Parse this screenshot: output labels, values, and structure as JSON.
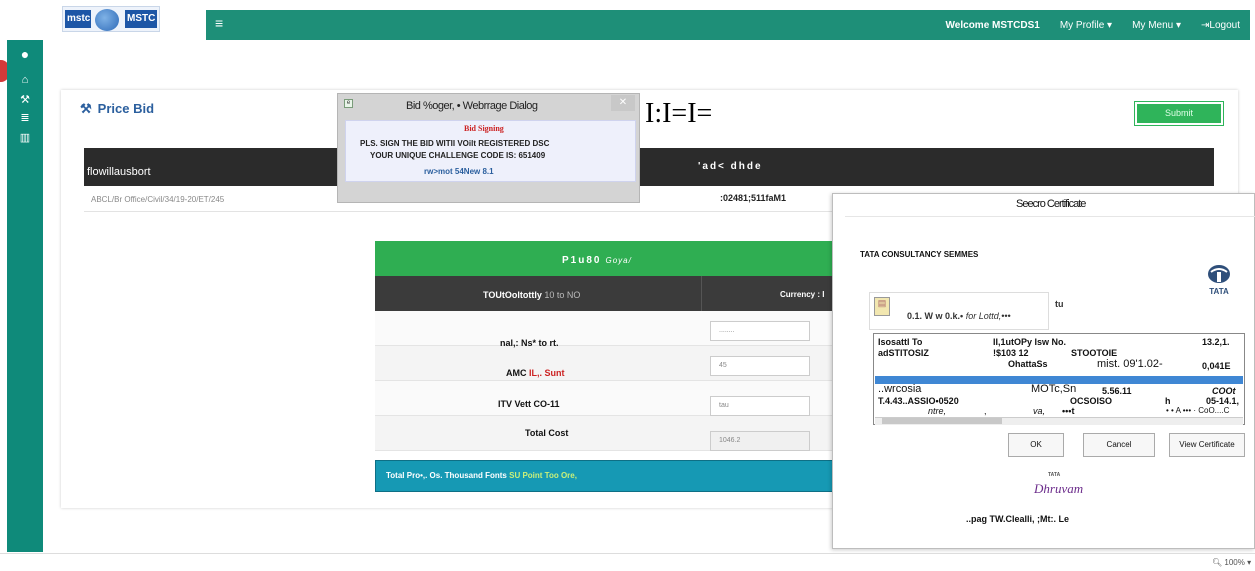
{
  "nav": {
    "logo_left": "mstc",
    "logo_right": "MSTC",
    "welcome": "Welcome MSTCDS1",
    "my_profile": "My Profile ▾",
    "my_menu": "My Menu ▾",
    "logout": "Logout"
  },
  "price_bid": {
    "title": "Price Bid",
    "big_mark": "I:I=I=",
    "button_label": "Submit",
    "header_left": "flowillausbort",
    "header_right": "'ad< dhde",
    "ref_text": "ABCL/Br Office/Civil/34/19-20/ET/245",
    "ref_number": ":02481;511faM1"
  },
  "price_table": {
    "green_label": "P1u80",
    "green_label_italic": "Goya/",
    "col1": "TOUtOoltottly",
    "col1_suffix": "10 to NO",
    "col2": "Currency : I",
    "rows": [
      {
        "label": "nal,: Ns* to rt.",
        "value": "........"
      },
      {
        "label": "AMC IL,. Sunt",
        "value": "45"
      },
      {
        "label": "ITV Vett CO-11",
        "value": "tau"
      },
      {
        "label": "Total Cost",
        "value": "1046.2"
      }
    ],
    "total_text": "Total Pro•,. Os. Thousand Fonts",
    "total_text_highlight": "SU Point Too Ore,"
  },
  "webpage_dialog": {
    "title": "Bid %oger, • Webrrage Dialog",
    "sign_label": "Bid Signing",
    "message1": "PLS. SIGN THE BID WITII VOilt REGISTERED DSC",
    "message2": "YOUR UNIQUE CHALLENGE CODE IS: 651409",
    "link": "rw>mot 54New 8.1"
  },
  "cert_dialog": {
    "title": "Seecro Certificate",
    "vendor": "TATA CONSULTANCY SEMMES",
    "info_top": "tu",
    "info_line": "0.1. W w 0.k.•",
    "info_line_italic": "for Lottd,•••",
    "table": {
      "r1": [
        "Isosattl To",
        "II,1utOPy Isw No.",
        "13.2,1."
      ],
      "r2": [
        "adSTITOSIZ",
        "!$103 12",
        "STOOTOIE"
      ],
      "r3": [
        "OhattaSs",
        "mist. 09'1.02-",
        "0,041E"
      ],
      "r4": [
        "..wrcosia",
        "MOTc,Sn",
        "5.56.11",
        "COOt"
      ],
      "r5": [
        "T.4.43..ASSIO•0520",
        "OCSOISO",
        "h",
        "05-14.1,"
      ],
      "r6": [
        "ntre,",
        ",",
        "va,",
        "•••t",
        "• • A ••• · CoO....C"
      ]
    },
    "ok": "OK",
    "cancel": "Cancel",
    "view": "View Certificate",
    "dhruvam_tata": "TATA",
    "dhruvam": "Dhruvam",
    "footer": "..pag    TW.Clealli, ;Mt:. Le"
  },
  "status": {
    "zoom": "100%"
  }
}
